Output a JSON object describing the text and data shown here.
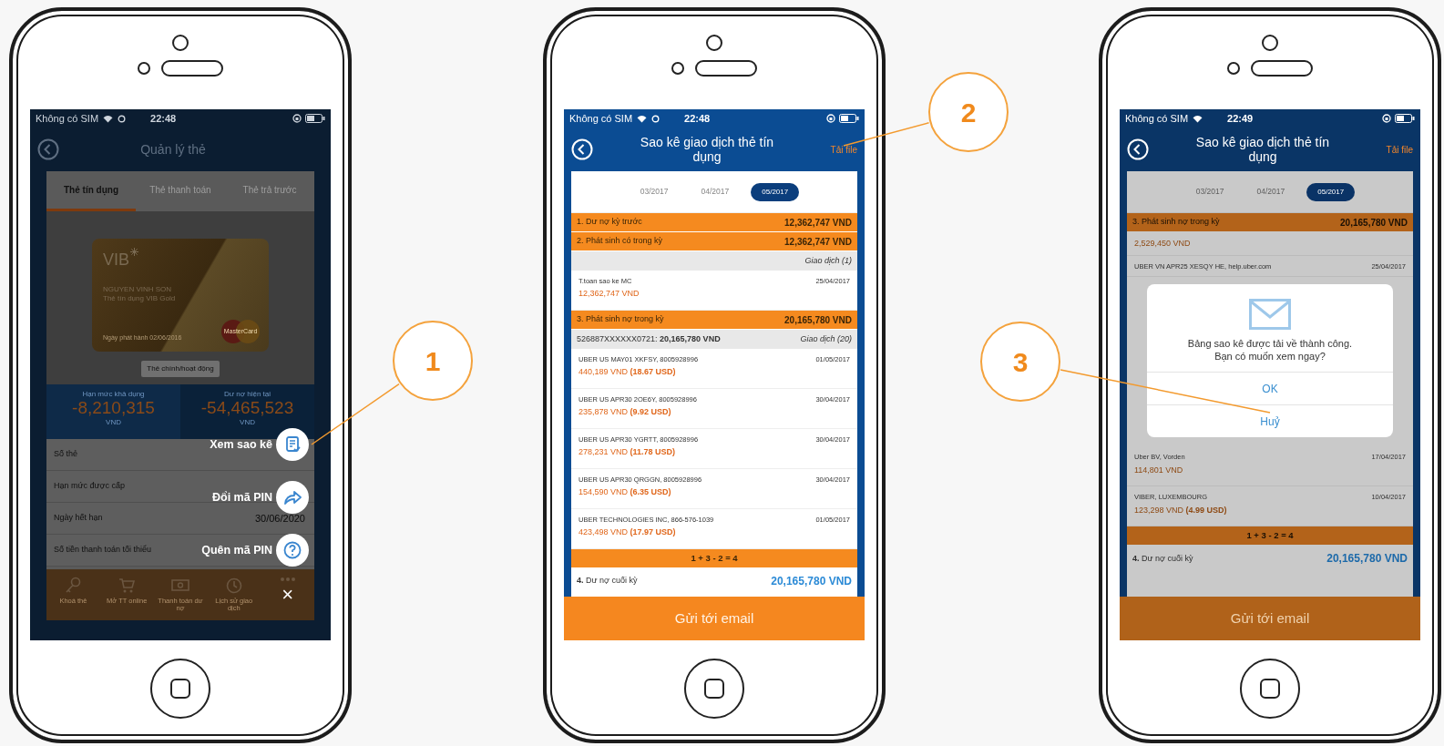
{
  "phones": [
    {
      "kind": "card_menu",
      "status_bar": {
        "carrier": "Không có SIM",
        "time": "22:48",
        "syncing": true
      },
      "title": "Quản lý thẻ",
      "tabs": [
        {
          "label": "Thẻ tín dụng",
          "selected": true
        },
        {
          "label": "Thẻ thanh toán",
          "selected": false
        },
        {
          "label": "Thẻ trả trước",
          "selected": false
        }
      ],
      "card": {
        "brand": "VIB",
        "holder": "NGUYEN VINH SON",
        "product": "Thẻ tín dụng VIB Gold",
        "issued": "Ngày phát hành 02/06/2016",
        "network": "MasterCard"
      },
      "card_status": "Thẻ chính/hoạt động",
      "stats": [
        {
          "label": "Hạn mức khả dụng",
          "value": "-8,210,315",
          "unit": "VND"
        },
        {
          "label": "Dư nợ hiện tại",
          "value": "-54,465,523",
          "unit": "VND"
        }
      ],
      "details": [
        {
          "label": "Số thẻ"
        },
        {
          "label": "Hạn mức được cấp"
        },
        {
          "label": "Ngày hết hạn",
          "value": "30/06/2020"
        },
        {
          "label": "Số tiền thanh toán tối thiểu"
        }
      ],
      "nav": [
        {
          "label": "Khoá thẻ"
        },
        {
          "label": "Mở TT online"
        },
        {
          "label": "Thanh toán dư nợ"
        },
        {
          "label": "Lịch sử giao dịch"
        }
      ],
      "menu": [
        {
          "label": "Xem sao kê"
        },
        {
          "label": "Đổi mã PIN"
        },
        {
          "label": "Quên mã PIN"
        }
      ],
      "close": "×"
    },
    {
      "kind": "statement",
      "status_bar": {
        "carrier": "Không có SIM",
        "time": "22:48",
        "syncing": true
      },
      "title": "Sao kê giao dịch thẻ tín dụng",
      "action": "Tải file",
      "months": [
        {
          "label": "03/2017",
          "selected": false
        },
        {
          "label": "04/2017",
          "selected": false
        },
        {
          "label": "05/2017",
          "selected": true
        }
      ],
      "rows": [
        {
          "kind": "section",
          "label": "1. Dư nợ kỳ trước",
          "amount": "12,362,747 VND"
        },
        {
          "kind": "section",
          "label": "2. Phát sinh có trong kỳ",
          "amount": "12,362,747 VND"
        },
        {
          "kind": "group",
          "count": "Giao dịch (1)"
        },
        {
          "kind": "txn",
          "merchant": "T.toan sao ke MC",
          "date": "25/04/2017",
          "amount": "12,362,747 VND"
        },
        {
          "kind": "section",
          "label": "3. Phát sinh nợ trong kỳ",
          "amount": "20,165,780 VND"
        },
        {
          "kind": "group",
          "label": "526887XXXXXX0721: **20,165,780 VND**",
          "count": "Giao dịch (20)"
        },
        {
          "kind": "txn",
          "merchant": "UBER US MAY01 XKFSY, 8005928996",
          "date": "01/05/2017",
          "amount": "440,189 VND **(18.67 USD)**"
        },
        {
          "kind": "txn",
          "merchant": "UBER US APR30 2OE6Y, 8005928996",
          "date": "30/04/2017",
          "amount": "235,878 VND **(9.92 USD)**"
        },
        {
          "kind": "txn",
          "merchant": "UBER US APR30 YGRTT, 8005928996",
          "date": "30/04/2017",
          "amount": "278,231 VND **(11.78 USD)**"
        },
        {
          "kind": "txn",
          "merchant": "UBER US APR30 QRGGN, 8005928996",
          "date": "30/04/2017",
          "amount": "154,590 VND **(6.35 USD)**"
        },
        {
          "kind": "txn",
          "merchant": "UBER TECHNOLOGIES INC, 866-576-1039",
          "date": "01/05/2017",
          "amount": "423,498 VND **(17.97 USD)**"
        },
        {
          "kind": "total",
          "label": "1 + 3 - 2 = 4"
        },
        {
          "kind": "closing",
          "label": "**4.** Dư nợ cuối kỳ",
          "amount": "20,165,780 VND"
        }
      ],
      "button": "Gửi tới email"
    },
    {
      "kind": "statement",
      "status_bar": {
        "carrier": "Không có SIM",
        "time": "22:49",
        "syncing": false
      },
      "title": "Sao kê giao dịch thẻ tín dụng",
      "action": "Tải file",
      "months": [
        {
          "label": "03/2017",
          "selected": false
        },
        {
          "label": "04/2017",
          "selected": false
        },
        {
          "label": "05/2017",
          "selected": true
        }
      ],
      "rows": [
        {
          "kind": "section",
          "label": "3. Phát sinh nợ trong kỳ",
          "amount": "20,165,780 VND"
        },
        {
          "kind": "txn",
          "amount": "2,529,450 VND"
        },
        {
          "kind": "txn",
          "merchant": "UBER VN APR25 XESQY HE, help.uber.com",
          "date": "25/04/2017"
        },
        {
          "kind": "dialog",
          "message": "Bảng sao kê được tải về thành công. Bạn có muốn xem ngay?",
          "buttons": [
            {
              "label": "OK"
            },
            {
              "label": "Huỷ"
            }
          ]
        },
        {
          "kind": "txn",
          "merchant": "Uber BV, Vorden",
          "date": "17/04/2017",
          "amount": "114,801 VND"
        },
        {
          "kind": "txn",
          "merchant": "VIBER, LUXEMBOURG",
          "date": "10/04/2017",
          "amount": "123,298 VND **(4.99 USD)**"
        },
        {
          "kind": "total",
          "label": "1 + 3 - 2 = 4"
        },
        {
          "kind": "closing",
          "label": "**4.** Dư nợ cuối kỳ",
          "amount": "20,165,780 VND"
        }
      ],
      "button": "Gửi tới email"
    }
  ],
  "callouts": [
    {
      "number": "1"
    },
    {
      "number": "2"
    },
    {
      "number": "3"
    }
  ]
}
